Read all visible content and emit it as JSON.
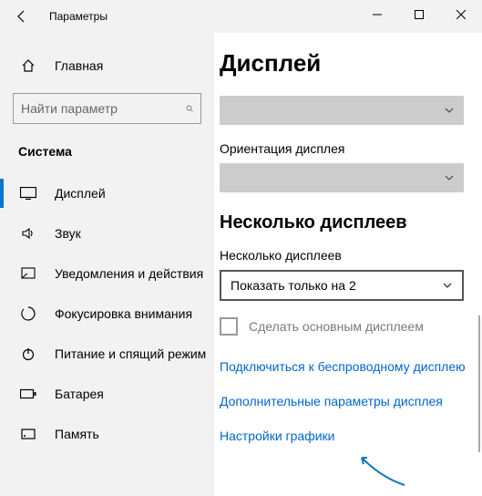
{
  "window": {
    "title": "Параметры"
  },
  "sidebar": {
    "home_label": "Главная",
    "search_placeholder": "Найти параметр",
    "category_label": "Система",
    "items": [
      {
        "label": "Дисплей"
      },
      {
        "label": "Звук"
      },
      {
        "label": "Уведомления и действия"
      },
      {
        "label": "Фокусировка внимания"
      },
      {
        "label": "Питание и спящий режим"
      },
      {
        "label": "Батарея"
      },
      {
        "label": "Память"
      }
    ]
  },
  "main": {
    "page_title": "Дисплей",
    "orientation_label": "Ориентация дисплея",
    "multi_heading": "Несколько дисплеев",
    "multi_label": "Несколько дисплеев",
    "multi_select_value": "Показать только на 2",
    "make_main_label": "Сделать основным дисплеем",
    "link_wireless": "Подключиться к беспроводному дисплею",
    "link_advanced": "Дополнительные параметры дисплея",
    "link_graphics": "Настройки графики"
  }
}
